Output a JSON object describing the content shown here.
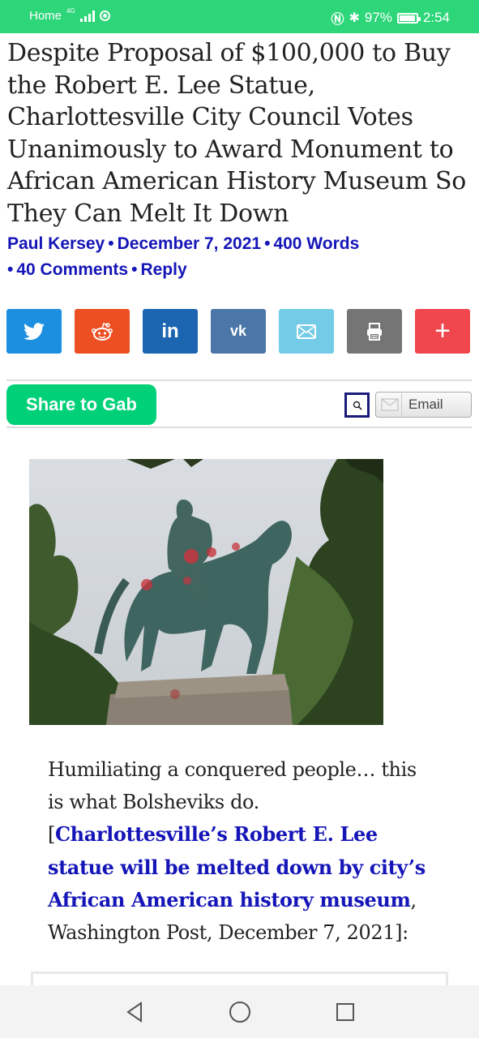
{
  "status_bar": {
    "carrier": "Home",
    "network": "4G",
    "battery": "97%",
    "time": "2:54"
  },
  "article": {
    "headline": "Despite Proposal of $100,000 to Buy the Robert E. Lee Statue, Charlottesville City Council Votes Unanimously to Award Monument to African American History Museum So They Can Melt It Down",
    "author": "Paul Kersey",
    "date": "December 7, 2021",
    "words": "400 Words",
    "comments": "40 Comments",
    "reply": "Reply",
    "separator": "•",
    "body_intro": "Humiliating a conquered people… this is what Bolsheviks do.",
    "link_open": "[",
    "link_text": "Charlottesville’s Robert E. Lee statue will be melted down by city’s African American history museum",
    "link_suffix": ", Washington Post, December 7, 2021]:"
  },
  "share": {
    "buttons": [
      {
        "name": "twitter",
        "icon": "twitter-bird-icon",
        "color": "#1d8fe0"
      },
      {
        "name": "reddit",
        "icon": "reddit-alien-icon",
        "color": "#ec4f22"
      },
      {
        "name": "linkedin",
        "icon": "linkedin-icon",
        "label": "in",
        "color": "#1c66b1"
      },
      {
        "name": "vk",
        "icon": "vk-icon",
        "label": "vk",
        "color": "#4a76a8"
      },
      {
        "name": "email",
        "icon": "envelope-icon",
        "color": "#74cbe8"
      },
      {
        "name": "print",
        "icon": "printer-icon",
        "color": "#757575"
      },
      {
        "name": "more",
        "icon": "plus-icon",
        "label": "+",
        "color": "#f0474f"
      }
    ],
    "gab_label": "Share to Gab",
    "email_label": "Email"
  },
  "colors": {
    "status_bar": "#2ed67a",
    "link": "#1515b8",
    "gab": "#00d178"
  }
}
